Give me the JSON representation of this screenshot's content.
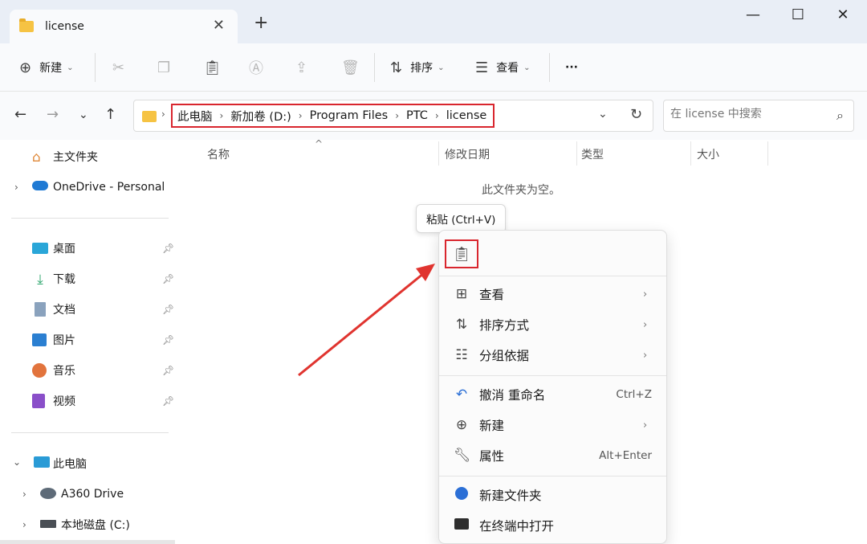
{
  "tab": {
    "title": "license",
    "close": "✕",
    "new": "+"
  },
  "window": {
    "minimize": "—",
    "maximize": "☐",
    "close": "✕"
  },
  "toolbar": {
    "new_label": "新建",
    "sort_label": "排序",
    "view_label": "查看",
    "more": "···"
  },
  "address": {
    "crumbs": [
      "此电脑",
      "新加卷 (D:)",
      "Program Files",
      "PTC",
      "license"
    ],
    "separator": "›"
  },
  "search": {
    "placeholder": "在 license 中搜索"
  },
  "sidebar": {
    "home": "主文件夹",
    "onedrive": "OneDrive - Personal",
    "quick": [
      "桌面",
      "下载",
      "文档",
      "图片",
      "音乐",
      "视频"
    ],
    "thispc": "此电脑",
    "drives": [
      "A360 Drive",
      "本地磁盘 (C:)"
    ]
  },
  "columns": {
    "name": "名称",
    "modified": "修改日期",
    "type": "类型",
    "size": "大小"
  },
  "empty_text": "此文件夹为空。",
  "tooltip": "粘贴 (Ctrl+V)",
  "context_menu": {
    "view": "查看",
    "sort": "排序方式",
    "group": "分组依据",
    "undo": "撤消 重命名",
    "undo_shortcut": "Ctrl+Z",
    "new": "新建",
    "properties": "属性",
    "properties_shortcut": "Alt+Enter",
    "new_folder": "新建文件夹",
    "terminal": "在终端中打开"
  },
  "colors": {
    "highlight": "#d9262e",
    "folder": "#f6c343"
  }
}
